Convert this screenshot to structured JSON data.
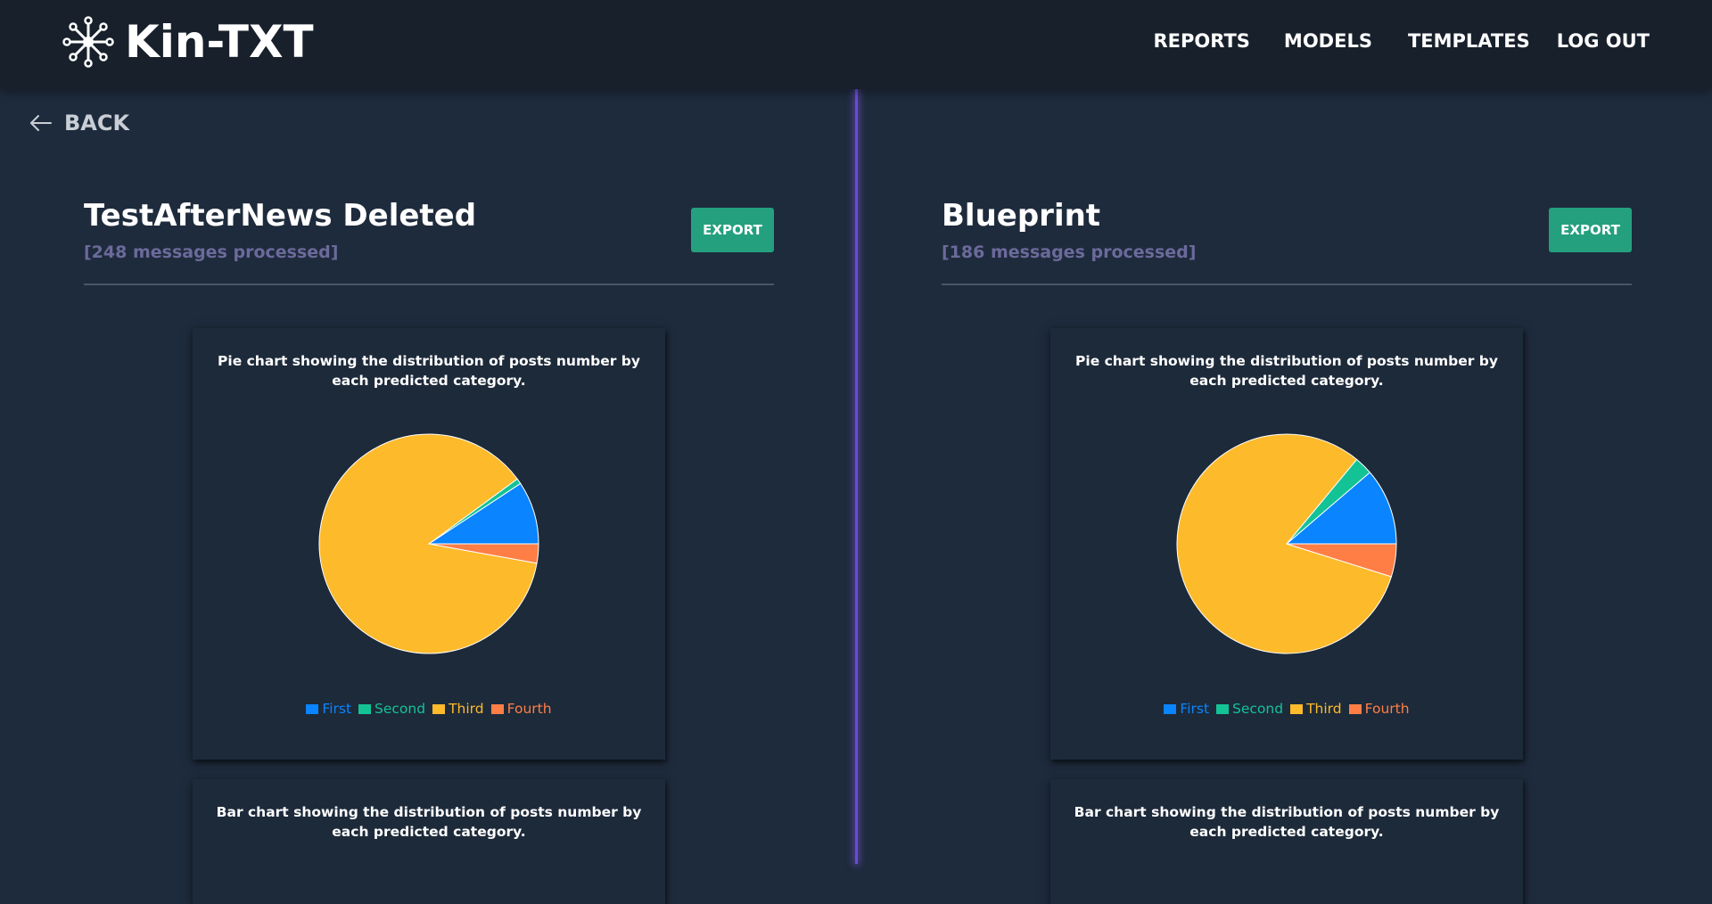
{
  "app": {
    "name": "Kin-TXT",
    "logo_icon": "network-node-icon"
  },
  "nav": {
    "reports": "REPORTS",
    "models": "MODELS",
    "templates": "TEMPLATES",
    "logout": "LOG OUT"
  },
  "back": {
    "label": "BACK",
    "icon": "arrow-left-icon"
  },
  "colors": {
    "topbar": "#17202b",
    "background": "#1e2b3c",
    "divider": "#6d4bd4",
    "export_button": "#24a07f",
    "subtitle": "#6b6a9b"
  },
  "panels": [
    {
      "title": "TestAfterNews Deleted",
      "subtitle": "[248 messages processed]",
      "export_label": "EXPORT",
      "pie_title": "Pie chart showing the distribution of posts number by each predicted category.",
      "bar_title": "Bar chart showing the distribution of posts number by each predicted category."
    },
    {
      "title": "Blueprint",
      "subtitle": "[186 messages processed]",
      "export_label": "EXPORT",
      "pie_title": "Pie chart showing the distribution of posts number by each predicted category.",
      "bar_title": "Bar chart showing the distribution of posts number by each predicted category."
    }
  ],
  "chart_data": [
    {
      "type": "pie",
      "title": "Pie chart showing the distribution of posts number by each predicted category.",
      "categories": [
        "First",
        "Second",
        "Third",
        "Fourth"
      ],
      "values": [
        23,
        2,
        216,
        7
      ],
      "colors": [
        "#0a84ff",
        "#13c395",
        "#fdba2b",
        "#ff7e45"
      ],
      "legend": "bottom"
    },
    {
      "type": "pie",
      "title": "Pie chart showing the distribution of posts number by each predicted category.",
      "categories": [
        "First",
        "Second",
        "Third",
        "Fourth"
      ],
      "values": [
        21,
        5,
        151,
        9
      ],
      "colors": [
        "#0a84ff",
        "#13c395",
        "#fdba2b",
        "#ff7e45"
      ],
      "legend": "bottom"
    }
  ]
}
